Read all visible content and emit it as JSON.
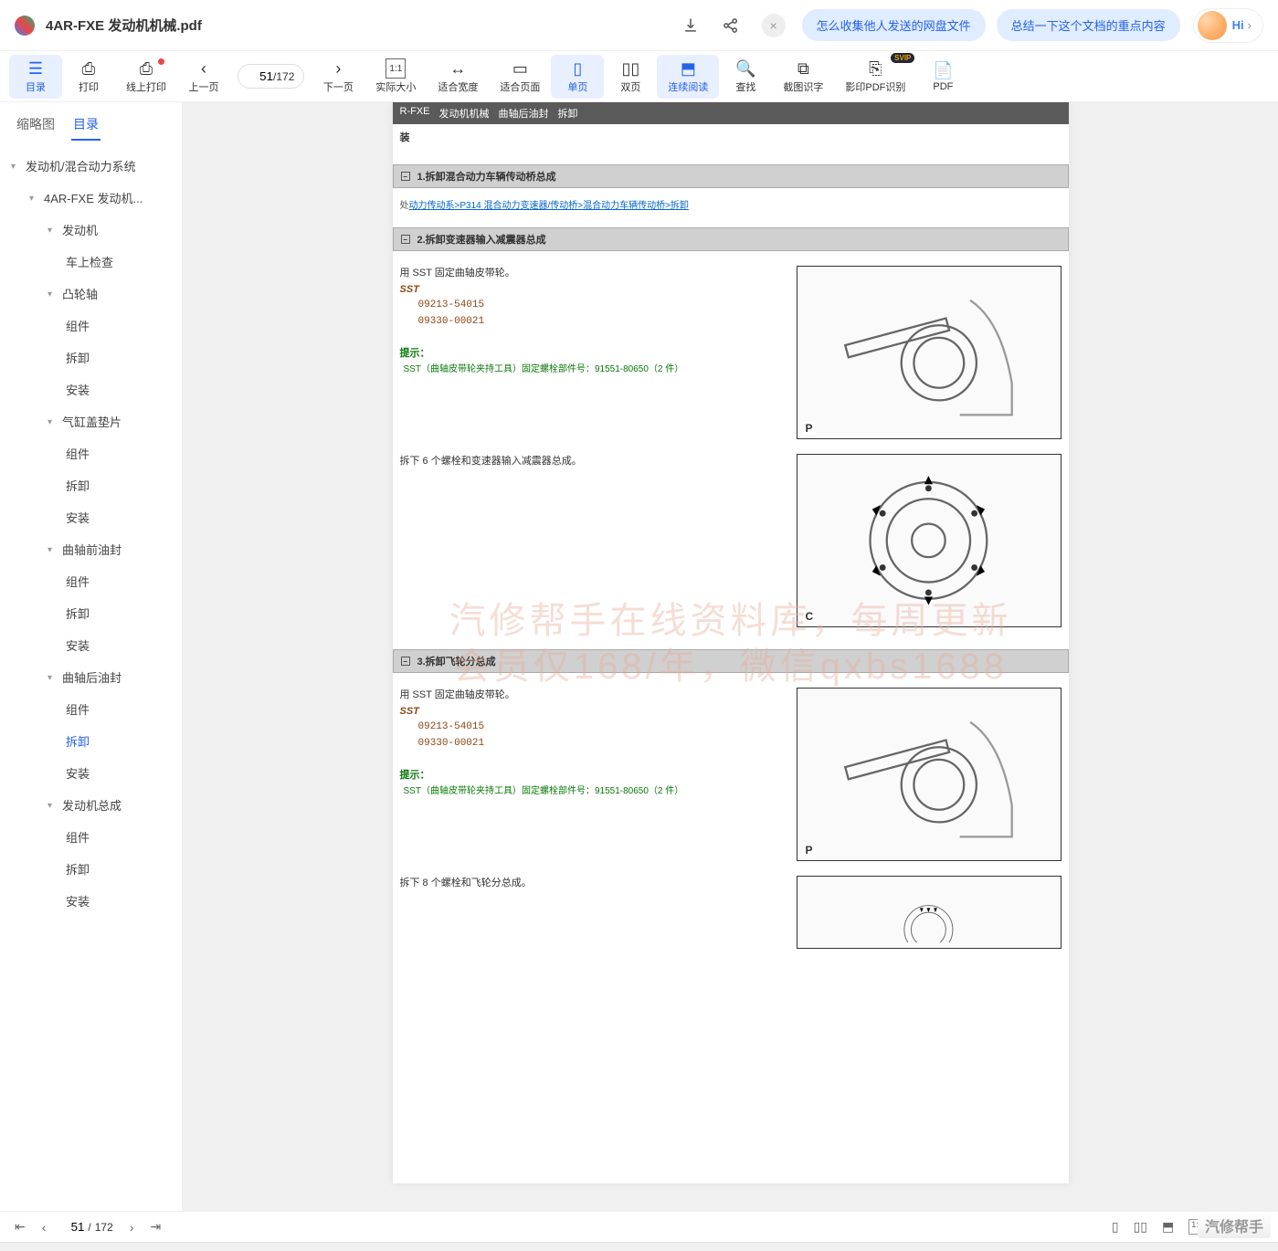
{
  "header": {
    "filename": "4AR-FXE 发动机机械.pdf",
    "pill1": "怎么收集他人发送的网盘文件",
    "pill2": "总结一下这个文档的重点内容",
    "hi": "Hi"
  },
  "toolbar": {
    "toc": "目录",
    "print": "打印",
    "netprint": "线上打印",
    "prev": "上一页",
    "page_current": "51",
    "page_sep": "/",
    "page_total": "172",
    "next": "下一页",
    "actual": "实际大小",
    "fitw": "适合宽度",
    "fitp": "适合页面",
    "single": "单页",
    "double": "双页",
    "continuous": "连续阅读",
    "find": "查找",
    "ocr": "截图识字",
    "pdfocr": "影印PDF识别",
    "svip": "SVIP",
    "pdf_edge": "PDF"
  },
  "sidebar": {
    "tab_thumb": "缩略图",
    "tab_toc": "目录",
    "items": [
      {
        "label": "发动机/混合动力系统",
        "indent": 0,
        "caret": true
      },
      {
        "label": "4AR-FXE 发动机...",
        "indent": 1,
        "caret": true
      },
      {
        "label": "发动机",
        "indent": 2,
        "caret": true
      },
      {
        "label": "车上检查",
        "indent": 3
      },
      {
        "label": "凸轮轴",
        "indent": 2,
        "caret": true
      },
      {
        "label": "组件",
        "indent": 3
      },
      {
        "label": "拆卸",
        "indent": 3
      },
      {
        "label": "安装",
        "indent": 3
      },
      {
        "label": "气缸盖垫片",
        "indent": 2,
        "caret": true
      },
      {
        "label": "组件",
        "indent": 3
      },
      {
        "label": "拆卸",
        "indent": 3
      },
      {
        "label": "安装",
        "indent": 3
      },
      {
        "label": "曲轴前油封",
        "indent": 2,
        "caret": true
      },
      {
        "label": "组件",
        "indent": 3
      },
      {
        "label": "拆卸",
        "indent": 3
      },
      {
        "label": "安装",
        "indent": 3
      },
      {
        "label": "曲轴后油封",
        "indent": 2,
        "caret": true
      },
      {
        "label": "组件",
        "indent": 3
      },
      {
        "label": "拆卸",
        "indent": 3,
        "selected": true
      },
      {
        "label": "安装",
        "indent": 3
      },
      {
        "label": "发动机总成",
        "indent": 2,
        "caret": true
      },
      {
        "label": "组件",
        "indent": 3
      },
      {
        "label": "拆卸",
        "indent": 3
      },
      {
        "label": "安装",
        "indent": 3
      }
    ]
  },
  "doc": {
    "header_parts": [
      "R-FXE",
      "发动机机械",
      "曲轴后油封",
      "拆卸"
    ],
    "step1": "1.拆卸混合动力车辆传动桥总成",
    "bc_prefix": "处",
    "bc_link": "动力传动系>P314 混合动力变速器/传动桥>混合动力车辆传动桥>拆卸",
    "step2": "2.拆卸变速器输入减震器总成",
    "txt_a1": "用 SST 固定曲轴皮带轮。",
    "sst": "SST",
    "sst_n1": "09213-54015",
    "sst_n2": "09330-00021",
    "hint_label": "提示：",
    "hint1": "SST（曲轴皮带轮夹持工具）固定螺栓部件号：91551-80650（2 件）",
    "txt_a2": "拆下 6 个螺栓和变速器输入减震器总成。",
    "step3": "3.拆卸飞轮分总成",
    "txt_b1": "用 SST 固定曲轴皮带轮。",
    "txt_b2": "拆下 8 个螺栓和飞轮分总成。",
    "figP": "P",
    "figC": "C",
    "watermark1": "汽修帮手在线资料库，每周更新",
    "watermark2": "会员仅168/年，微信qxbs1688"
  },
  "footer": {
    "current": "51",
    "total": "172",
    "logo": "汽修帮手"
  }
}
